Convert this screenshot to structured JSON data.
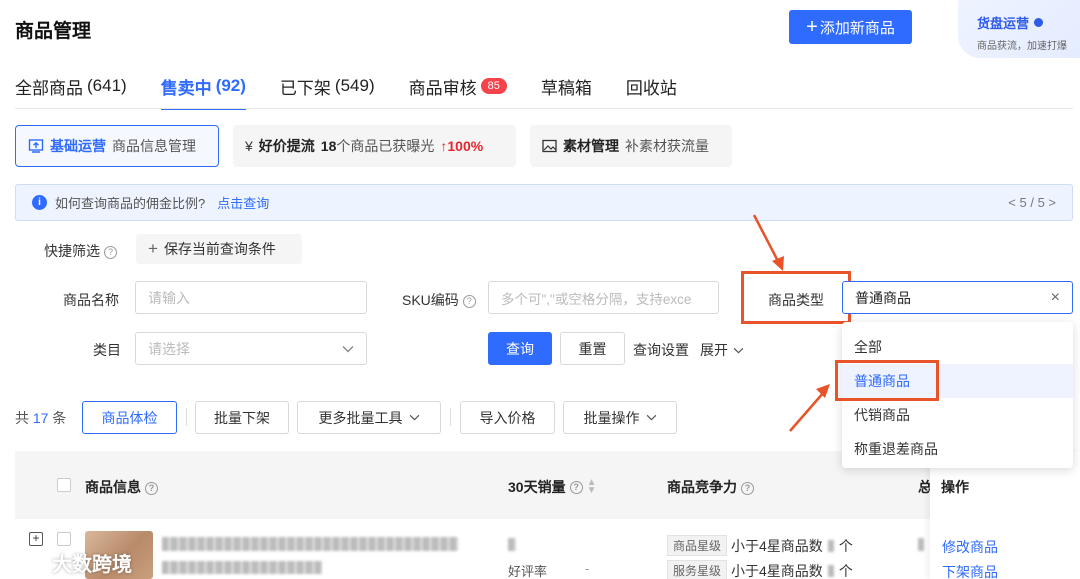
{
  "header": {
    "title": "商品管理",
    "add_button": "添加新商品",
    "promo_title": "货盘运营",
    "promo_sub": "商品获流，加速打爆"
  },
  "tabs": [
    {
      "label": "全部商品",
      "count": "(641)"
    },
    {
      "label": "售卖中",
      "count": "(92)"
    },
    {
      "label": "已下架",
      "count": "(549)"
    },
    {
      "label": "商品审核",
      "badge": "85"
    },
    {
      "label": "草稿箱"
    },
    {
      "label": "回收站"
    }
  ],
  "cards": {
    "basic": {
      "title": "基础运营",
      "sub": "商品信息管理"
    },
    "price": {
      "icon": "¥",
      "title": "好价提流",
      "num": "18",
      "text": "个商品已获曝光",
      "pct": "100%"
    },
    "material": {
      "title": "素材管理",
      "sub": "补素材获流量"
    }
  },
  "notice": {
    "text": "如何查询商品的佣金比例?",
    "link": "点击查询",
    "pager": "< 5 / 5 >"
  },
  "filters": {
    "quick": "快捷筛选",
    "save": "保存当前查询条件",
    "name_label": "商品名称",
    "name_placeholder": "请输入",
    "sku_label": "SKU编码",
    "sku_placeholder": "多个可\",\"或空格分隔，支持exce",
    "type_label": "商品类型",
    "type_value": "普通商品",
    "cat_label": "类目",
    "cat_placeholder": "请选择",
    "query": "查询",
    "reset": "重置",
    "settings": "查询设置",
    "expand": "展开"
  },
  "type_options": [
    "全部",
    "普通商品",
    "代销商品",
    "称重退差商品"
  ],
  "toolbar": {
    "total_prefix": "共",
    "total_num": "17",
    "total_suffix": "条",
    "check": "商品体检",
    "batch_off": "批量下架",
    "more_tools": "更多批量工具",
    "import_price": "导入价格",
    "batch_ops": "批量操作"
  },
  "table": {
    "headers": {
      "info": "商品信息",
      "sales": "30天销量",
      "comp": "商品竞争力",
      "total": "总",
      "ops": "操作"
    },
    "row": {
      "rating_label": "好评率",
      "rating_value": "-",
      "tag1": "商品星级",
      "tag1_text": "小于4星商品数",
      "tag1_unit": "个",
      "tag2": "服务星级",
      "tag2_text": "小于4星商品数",
      "tag2_unit": "个",
      "op1": "修改商品",
      "op2": "下架商品"
    }
  },
  "watermark": "大数跨境"
}
